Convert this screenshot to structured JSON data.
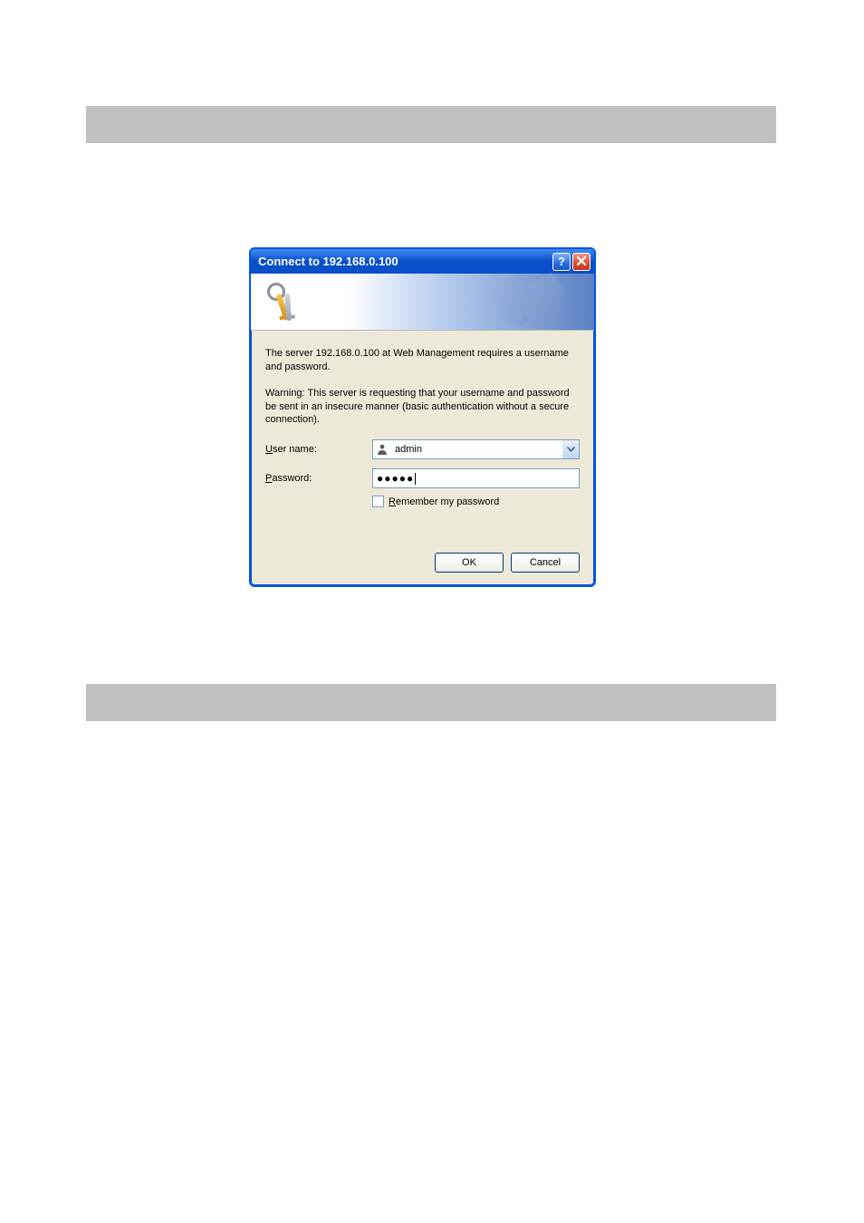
{
  "titlebar": {
    "title": "Connect to 192.168.0.100"
  },
  "messages": {
    "server_msg": "The server 192.168.0.100 at Web Management requires a username and password.",
    "warning_msg": "Warning: This server is requesting that your username and password be sent in an insecure manner (basic authentication without a secure connection)."
  },
  "labels": {
    "username_prefix": "U",
    "username_rest": "ser name:",
    "password_prefix": "P",
    "password_rest": "assword:",
    "remember_prefix": "R",
    "remember_rest": "emember my password"
  },
  "fields": {
    "username_value": "admin",
    "password_masked": "●●●●●"
  },
  "buttons": {
    "ok": "OK",
    "cancel": "Cancel"
  }
}
